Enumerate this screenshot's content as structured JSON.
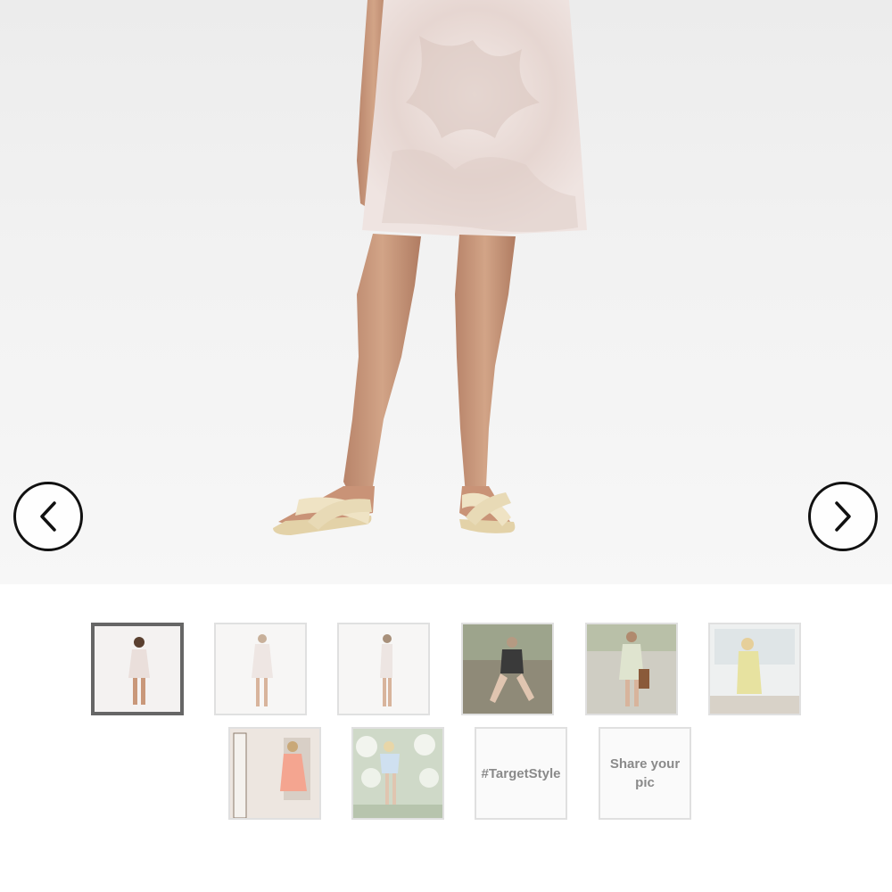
{
  "gallery": {
    "prev_icon": "chevron-left-icon",
    "next_icon": "chevron-right-icon",
    "thumbnails": [
      {
        "kind": "image",
        "label": ""
      },
      {
        "kind": "image",
        "label": ""
      },
      {
        "kind": "image",
        "label": ""
      },
      {
        "kind": "image",
        "label": ""
      },
      {
        "kind": "image",
        "label": ""
      },
      {
        "kind": "image",
        "label": ""
      },
      {
        "kind": "image",
        "label": ""
      },
      {
        "kind": "image",
        "label": ""
      },
      {
        "kind": "text",
        "label": "#TargetStyle"
      },
      {
        "kind": "text",
        "label": "Share your pic"
      }
    ],
    "selected_index": 0
  },
  "colors": {
    "dress": "#e9dcd8",
    "skin": "#c9987a",
    "sandal": "#efe3c4",
    "border": "#e0e0e0",
    "selected_border": "#666666"
  }
}
